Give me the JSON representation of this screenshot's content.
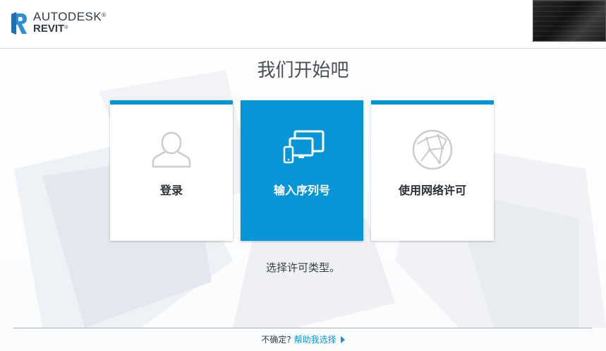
{
  "brand": {
    "company": "AUTODESK",
    "product": "REVIT",
    "trademark": "®"
  },
  "main": {
    "title": "我们开始吧",
    "cards": [
      {
        "label": "登录",
        "icon": "user-icon",
        "selected": false
      },
      {
        "label": "输入序列号",
        "icon": "devices-icon",
        "selected": true
      },
      {
        "label": "使用网络许可",
        "icon": "network-globe-icon",
        "selected": false
      }
    ],
    "hint": "选择许可类型。"
  },
  "footer": {
    "question": "不确定?",
    "help_link": "帮助我选择"
  },
  "colors": {
    "accent": "#0696d7",
    "text": "#333a44"
  }
}
